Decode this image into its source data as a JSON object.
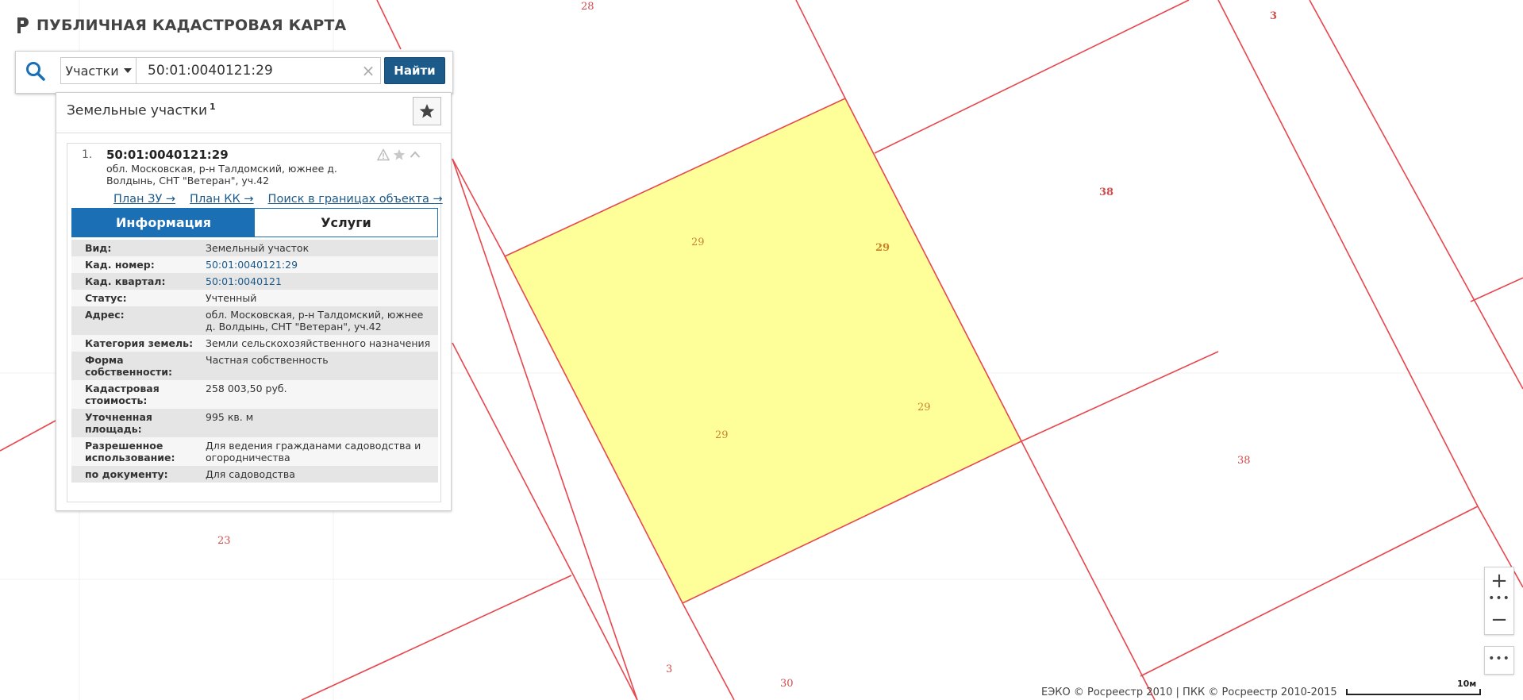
{
  "app": {
    "title": "ПУБЛИЧНАЯ КАДАСТРОВАЯ КАРТА"
  },
  "search": {
    "type_label": "Участки",
    "value": "50:01:0040121:29",
    "clear_label": "×",
    "button_label": "Найти"
  },
  "results": {
    "title": "Земельные участки",
    "count": "1",
    "item": {
      "number": "1.",
      "cad_number": "50:01:0040121:29",
      "address": "обл. Московская, р-н Талдомский, южнее д. Волдынь, СНТ \"Ветеран\", уч.42",
      "links": [
        "План ЗУ →",
        "План КК →",
        "Поиск в границах объекта →"
      ],
      "tabs": [
        "Информация",
        "Услуги"
      ],
      "active_tab": "Информация",
      "properties": [
        {
          "key": "Вид:",
          "value": "Земельный участок",
          "link": false
        },
        {
          "key": "Кад. номер:",
          "value": "50:01:0040121:29",
          "link": true
        },
        {
          "key": "Кад. квартал:",
          "value": "50:01:0040121",
          "link": true
        },
        {
          "key": "Статус:",
          "value": "Учтенный",
          "link": false
        },
        {
          "key": "Адрес:",
          "value": "обл. Московская, р-н Талдомский, южнее д. Волдынь, СНТ \"Ветеран\", уч.42",
          "link": false
        },
        {
          "key": "Категория земель:",
          "value": "Земли сельскохозяйственного назначения",
          "link": false
        },
        {
          "key": "Форма собственности:",
          "value": "Частная собственность",
          "link": false
        },
        {
          "key": "Кадастровая стоимость:",
          "value": "258 003,50 руб.",
          "link": false
        },
        {
          "key": "Уточненная площадь:",
          "value": "995 кв. м",
          "link": false
        },
        {
          "key": "Разрешенное использование:",
          "value": "Для ведения гражданами садоводства и огородничества",
          "link": false
        },
        {
          "key": "по документу:",
          "value": "Для садоводства",
          "link": false
        }
      ]
    }
  },
  "map": {
    "parcel_labels": [
      "28",
      "3",
      "38",
      "29",
      "29",
      "29",
      "29",
      "38",
      "23",
      "3",
      "30"
    ],
    "selected_fill": "#ffff99",
    "boundary_color": "#e8464d",
    "controls": {
      "zoom_in": "+",
      "zoom_out": "−",
      "dots": "•••",
      "more": "•••"
    },
    "attribution": "ЕЭКО © Росреестр 2010 | ПКК © Росреестр 2010-2015",
    "scale": "10м"
  },
  "colors": {
    "brand_blue": "#1a6fb5",
    "button_blue": "#1c5a8a",
    "boundary_red": "#e8464d",
    "selected_yellow": "#ffff99"
  },
  "icons": [
    "logo-icon",
    "search-icon",
    "star-icon",
    "warning-icon",
    "chevron-up-icon",
    "caret-down-icon"
  ]
}
